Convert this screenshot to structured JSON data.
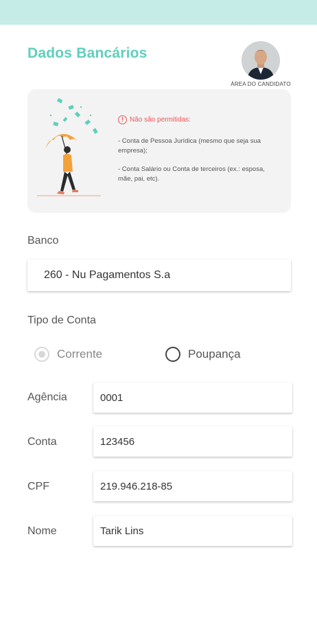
{
  "header": {
    "title": "Dados Bancários",
    "avatar_caption": "ÁREA DO CANDIDATO"
  },
  "notice": {
    "warning_title": "Não são permitidas:",
    "rules": [
      "- Conta de Pessoa Jurídica (mesmo que seja sua empresa);",
      "- Conta Salário ou Conta de terceiros (ex.: esposa, mãe, pai, etc)."
    ]
  },
  "form": {
    "bank_label": "Banco",
    "bank_value": "260 - Nu Pagamentos S.a",
    "account_type_label": "Tipo de Conta",
    "account_type_options": [
      {
        "label": "Corrente",
        "state": "disabled-selected"
      },
      {
        "label": "Poupança",
        "state": "unselected"
      }
    ],
    "agency_label": "Agência",
    "agency_value": "0001",
    "account_label": "Conta",
    "account_value": "123456",
    "cpf_label": "CPF",
    "cpf_value": "219.946.218-85",
    "name_label": "Nome",
    "name_value": "Tarik Lins"
  },
  "colors": {
    "accent": "#5fcfbd",
    "status_bar": "#c5ece6",
    "warning": "#e8555a",
    "umbrella": "#f3a23a"
  },
  "icons": [
    "warning-circle-icon",
    "avatar-photo",
    "umbrella-person-illustration"
  ]
}
